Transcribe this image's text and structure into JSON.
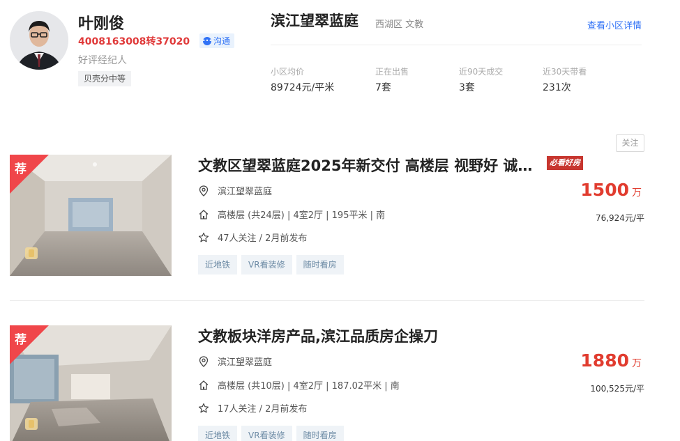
{
  "agent": {
    "name": "叶刚俊",
    "phone": "4008163008转37020",
    "chat_label": "沟通",
    "role": "好评经纪人",
    "tag": "贝壳分中等"
  },
  "community": {
    "name": "滨江望翠蓝庭",
    "area": "西湖区 文教",
    "detail_link": "查看小区详情",
    "stats": [
      {
        "label": "小区均价",
        "value": "89724元/平米"
      },
      {
        "label": "正在出售",
        "value": "7套"
      },
      {
        "label": "近90天成交",
        "value": "3套"
      },
      {
        "label": "近30天带看",
        "value": "231次"
      }
    ]
  },
  "follow_label": "关注",
  "listings": [
    {
      "badge": "荐",
      "title": "文教区望翠蓝庭2025年新交付 高楼层 视野好 诚…",
      "must_see": "必看好房",
      "community": "滨江望翠蓝庭",
      "details": "高楼层 (共24层) | 4室2厅 | 195平米 | 南",
      "follow_info": "47人关注 / 2月前发布",
      "price": "1500",
      "price_unit": "万",
      "unit_price": "76,924元/平",
      "tags": [
        "近地铁",
        "VR看装修",
        "随时看房"
      ]
    },
    {
      "badge": "荐",
      "title": "文教板块洋房产品,滨江品质房企操刀",
      "community": "滨江望翠蓝庭",
      "details": "高楼层 (共10层) | 4室2厅 | 187.02平米 | 南",
      "follow_info": "17人关注 / 2月前发布",
      "price": "1880",
      "price_unit": "万",
      "unit_price": "100,525元/平",
      "tags": [
        "近地铁",
        "VR看装修",
        "随时看房"
      ]
    }
  ]
}
